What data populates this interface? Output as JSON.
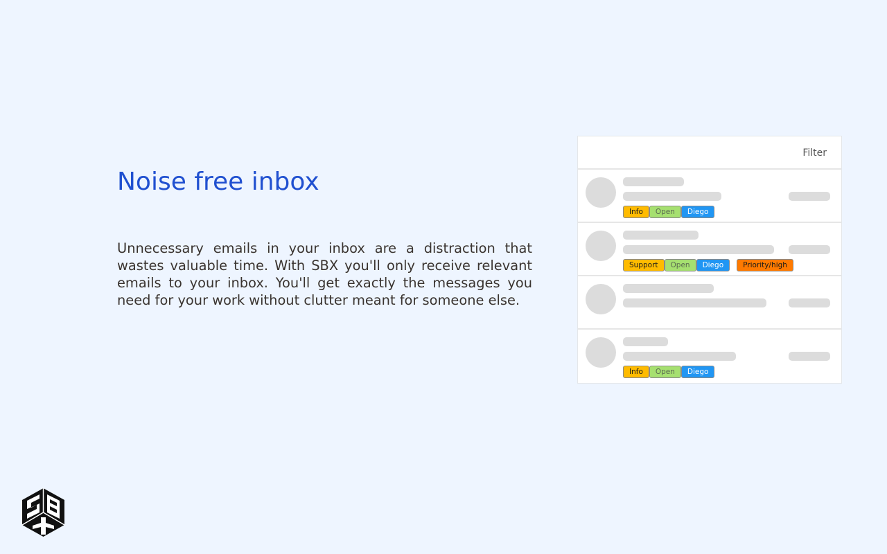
{
  "hero": {
    "title": "Noise free inbox",
    "description": "Unnecessary emails in your inbox are a distraction that wastes valuable time. With SBX you'll only receive relevant emails to your inbox. You'll get exactly the messages you need for your work without clutter meant for someone else."
  },
  "inbox": {
    "filter_label": "Filter",
    "rows": [
      {
        "tags": [
          {
            "label": "Info",
            "kind": "info"
          },
          {
            "label": "Open",
            "kind": "open"
          },
          {
            "label": "Diego",
            "kind": "diego"
          }
        ]
      },
      {
        "tags": [
          {
            "label": "Support",
            "kind": "support"
          },
          {
            "label": "Open",
            "kind": "open"
          },
          {
            "label": "Diego",
            "kind": "diego"
          },
          {
            "label": "Priority/high",
            "kind": "priority"
          }
        ]
      },
      {
        "tags": []
      },
      {
        "tags": [
          {
            "label": "Info",
            "kind": "info"
          },
          {
            "label": "Open",
            "kind": "open"
          },
          {
            "label": "Diego",
            "kind": "diego"
          }
        ]
      }
    ]
  },
  "logo": {
    "icon": "sbx-logo-icon"
  },
  "colors": {
    "background": "#eef5ff",
    "title": "#2050d0",
    "tag_info": "#ffbb00",
    "tag_open": "#a6e070",
    "tag_assignee": "#2196f3",
    "tag_priority": "#ff7a00"
  }
}
